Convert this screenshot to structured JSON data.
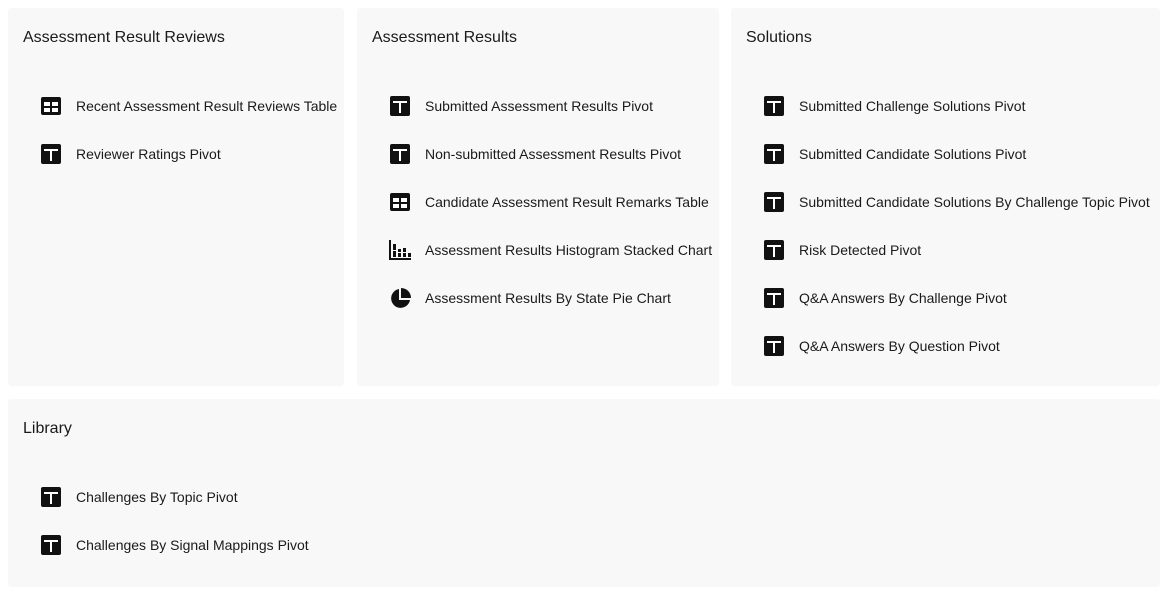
{
  "sections": {
    "reviews": {
      "title": "Assessment Result Reviews",
      "items": [
        {
          "label": "Recent Assessment Result Reviews Table",
          "icon": "table-icon"
        },
        {
          "label": "Reviewer Ratings Pivot",
          "icon": "pivot-icon"
        }
      ]
    },
    "results": {
      "title": "Assessment Results",
      "items": [
        {
          "label": "Submitted Assessment Results Pivot",
          "icon": "pivot-icon"
        },
        {
          "label": "Non-submitted Assessment Results Pivot",
          "icon": "pivot-icon"
        },
        {
          "label": "Candidate Assessment Result Remarks Table",
          "icon": "table-icon"
        },
        {
          "label": "Assessment Results Histogram Stacked Chart",
          "icon": "stacked-chart-icon"
        },
        {
          "label": "Assessment Results By State Pie Chart",
          "icon": "pie-chart-icon"
        }
      ]
    },
    "solutions": {
      "title": "Solutions",
      "items": [
        {
          "label": "Submitted Challenge Solutions Pivot",
          "icon": "pivot-icon"
        },
        {
          "label": "Submitted Candidate Solutions Pivot",
          "icon": "pivot-icon"
        },
        {
          "label": "Submitted Candidate Solutions By Challenge Topic Pivot",
          "icon": "pivot-icon"
        },
        {
          "label": "Risk Detected Pivot",
          "icon": "pivot-icon"
        },
        {
          "label": "Q&A Answers By Challenge Pivot",
          "icon": "pivot-icon"
        },
        {
          "label": "Q&A Answers By Question Pivot",
          "icon": "pivot-icon"
        }
      ]
    },
    "library": {
      "title": "Library",
      "items": [
        {
          "label": "Challenges By Topic Pivot",
          "icon": "pivot-icon"
        },
        {
          "label": "Challenges By Signal Mappings Pivot",
          "icon": "pivot-icon"
        }
      ]
    }
  }
}
